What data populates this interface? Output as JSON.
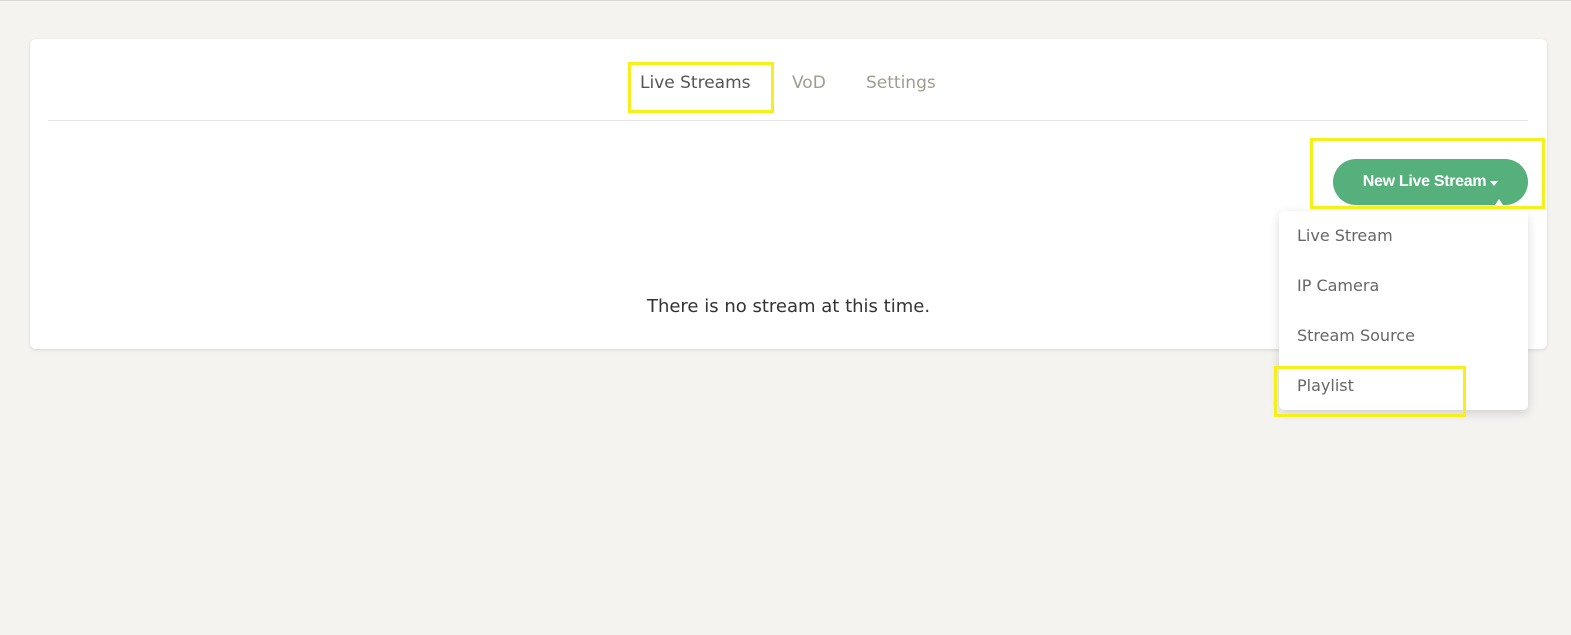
{
  "tabs": [
    {
      "label": "Live Streams",
      "active": true
    },
    {
      "label": "VoD",
      "active": false
    },
    {
      "label": "Settings",
      "active": false
    }
  ],
  "new_button": {
    "label": "New Live Stream",
    "color": "#55b07c"
  },
  "empty_message": "There is no stream at this time.",
  "dropdown": {
    "items": [
      {
        "label": "Live Stream"
      },
      {
        "label": "IP Camera"
      },
      {
        "label": "Stream Source"
      },
      {
        "label": "Playlist"
      }
    ]
  },
  "colors": {
    "background": "#f4f3f0",
    "highlight": "#f7ef1a",
    "tab_inactive": "#a09b93"
  }
}
